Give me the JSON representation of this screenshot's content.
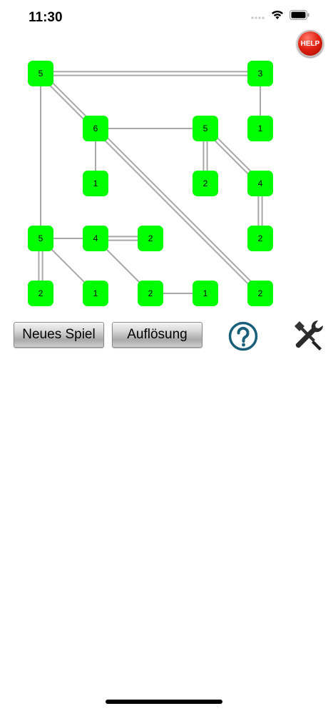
{
  "status_bar": {
    "time": "11:30"
  },
  "help_button": {
    "label": "HELP",
    "color": "#e02010"
  },
  "board": {
    "island_color": "#00ff00",
    "bridge_color": "#a8a8a8",
    "islands": [
      {
        "id": "a",
        "col": 0,
        "row": 0,
        "value": "5"
      },
      {
        "id": "b",
        "col": 4,
        "row": 0,
        "value": "3"
      },
      {
        "id": "c",
        "col": 1,
        "row": 1,
        "value": "6"
      },
      {
        "id": "d",
        "col": 3,
        "row": 1,
        "value": "5"
      },
      {
        "id": "e",
        "col": 4,
        "row": 1,
        "value": "1"
      },
      {
        "id": "f",
        "col": 1,
        "row": 2,
        "value": "1"
      },
      {
        "id": "g",
        "col": 3,
        "row": 2,
        "value": "2"
      },
      {
        "id": "h",
        "col": 4,
        "row": 2,
        "value": "4"
      },
      {
        "id": "i",
        "col": 0,
        "row": 3,
        "value": "5"
      },
      {
        "id": "j",
        "col": 1,
        "row": 3,
        "value": "4"
      },
      {
        "id": "k",
        "col": 2,
        "row": 3,
        "value": "2"
      },
      {
        "id": "l",
        "col": 4,
        "row": 3,
        "value": "2"
      },
      {
        "id": "m",
        "col": 0,
        "row": 4,
        "value": "2"
      },
      {
        "id": "n",
        "col": 1,
        "row": 4,
        "value": "1"
      },
      {
        "id": "o",
        "col": 2,
        "row": 4,
        "value": "2"
      },
      {
        "id": "p",
        "col": 3,
        "row": 4,
        "value": "1"
      },
      {
        "id": "q",
        "col": 4,
        "row": 4,
        "value": "2"
      }
    ],
    "bridges": [
      {
        "from": "a",
        "to": "b",
        "count": 2
      },
      {
        "from": "a",
        "to": "c",
        "count": 2
      },
      {
        "from": "a",
        "to": "i",
        "count": 1
      },
      {
        "from": "b",
        "to": "e",
        "count": 1
      },
      {
        "from": "c",
        "to": "d",
        "count": 1
      },
      {
        "from": "c",
        "to": "f",
        "count": 1
      },
      {
        "from": "c",
        "to": "q",
        "count": 2
      },
      {
        "from": "d",
        "to": "g",
        "count": 2
      },
      {
        "from": "d",
        "to": "h",
        "count": 2
      },
      {
        "from": "h",
        "to": "l",
        "count": 2
      },
      {
        "from": "i",
        "to": "j",
        "count": 1
      },
      {
        "from": "i",
        "to": "m",
        "count": 2
      },
      {
        "from": "i",
        "to": "n",
        "count": 1
      },
      {
        "from": "j",
        "to": "k",
        "count": 2
      },
      {
        "from": "j",
        "to": "o",
        "count": 1
      },
      {
        "from": "o",
        "to": "p",
        "count": 1
      }
    ]
  },
  "controls": {
    "new_game_label": "Neues Spiel",
    "solve_label": "Auflösung",
    "question_icon": "question-circle-icon",
    "question_color": "#1a5f7a",
    "tools_icon": "wrench-screwdriver-icon"
  }
}
